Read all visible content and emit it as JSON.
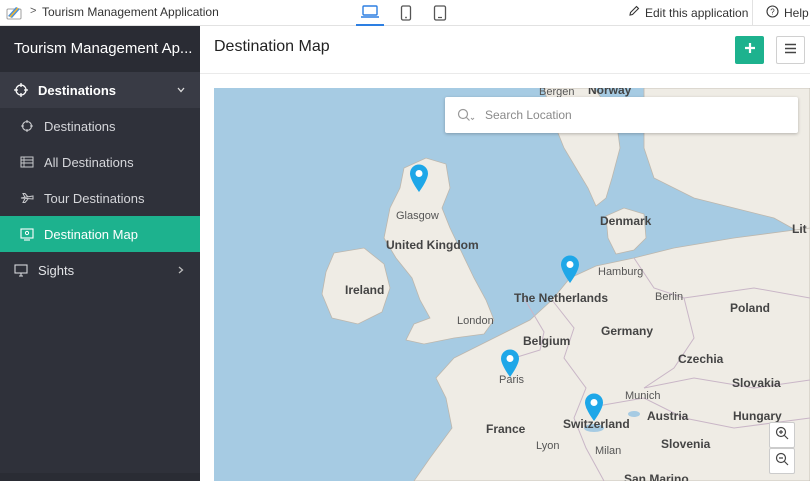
{
  "topbar": {
    "app_name": "Tourism Management Application",
    "breadcrumb_separator": ">",
    "devices": [
      "laptop-icon",
      "phone-icon",
      "tablet-icon"
    ],
    "active_device": "laptop",
    "edit_label": "Edit this application",
    "help_label": "Help"
  },
  "sidebar": {
    "app_title": "Tourism Management Ap...",
    "groups": [
      {
        "label": "Destinations",
        "icon": "crosshair-icon",
        "expanded": true,
        "items": [
          {
            "label": "Destinations",
            "icon": "crosshair-icon"
          },
          {
            "label": "All Destinations",
            "icon": "list-icon"
          },
          {
            "label": "Tour Destinations",
            "icon": "plane-icon"
          },
          {
            "label": "Destination Map",
            "icon": "map-icon",
            "selected": true
          }
        ]
      },
      {
        "label": "Sights",
        "icon": "monitor-icon",
        "expanded": false
      }
    ]
  },
  "main": {
    "title": "Destination Map",
    "add_button": "+",
    "search": {
      "placeholder": "Search Location",
      "value": ""
    },
    "map_labels": {
      "cities": [
        "Bergen",
        "Glasgow",
        "London",
        "Paris",
        "Lyon",
        "Milan",
        "Hamburg",
        "Berlin",
        "Munich"
      ],
      "countries": [
        "Norway",
        "Denmark",
        "United Kingdom",
        "Ireland",
        "The Netherlands",
        "Belgium",
        "Germany",
        "Poland",
        "Czechia",
        "Slovakia",
        "Austria",
        "Hungary",
        "Slovenia",
        "Switzerland",
        "France",
        "Lit",
        "San Marino"
      ]
    },
    "map_text": {
      "bergen": "Bergen",
      "norway": "Norway",
      "glasgow": "Glasgow",
      "denmark": "Denmark",
      "lit": "Lit",
      "uk": "United Kingdom",
      "hamburg": "Hamburg",
      "ireland": "Ireland",
      "netherlands": "The Netherlands",
      "berlin": "Berlin",
      "poland": "Poland",
      "london": "London",
      "germany": "Germany",
      "belgium": "Belgium",
      "czechia": "Czechia",
      "paris": "Paris",
      "slovakia": "Slovakia",
      "munich": "Munich",
      "austria": "Austria",
      "hungary": "Hungary",
      "france": "France",
      "switzerland": "Switzerland",
      "lyon": "Lyon",
      "slovenia": "Slovenia",
      "milan": "Milan",
      "san_marino": "San Marino"
    },
    "colors": {
      "sea": "#a6cbe3",
      "land": "#efece5",
      "pin": "#1ea7e8",
      "accent": "#1db28e",
      "sidebar": "#2f313a"
    }
  }
}
